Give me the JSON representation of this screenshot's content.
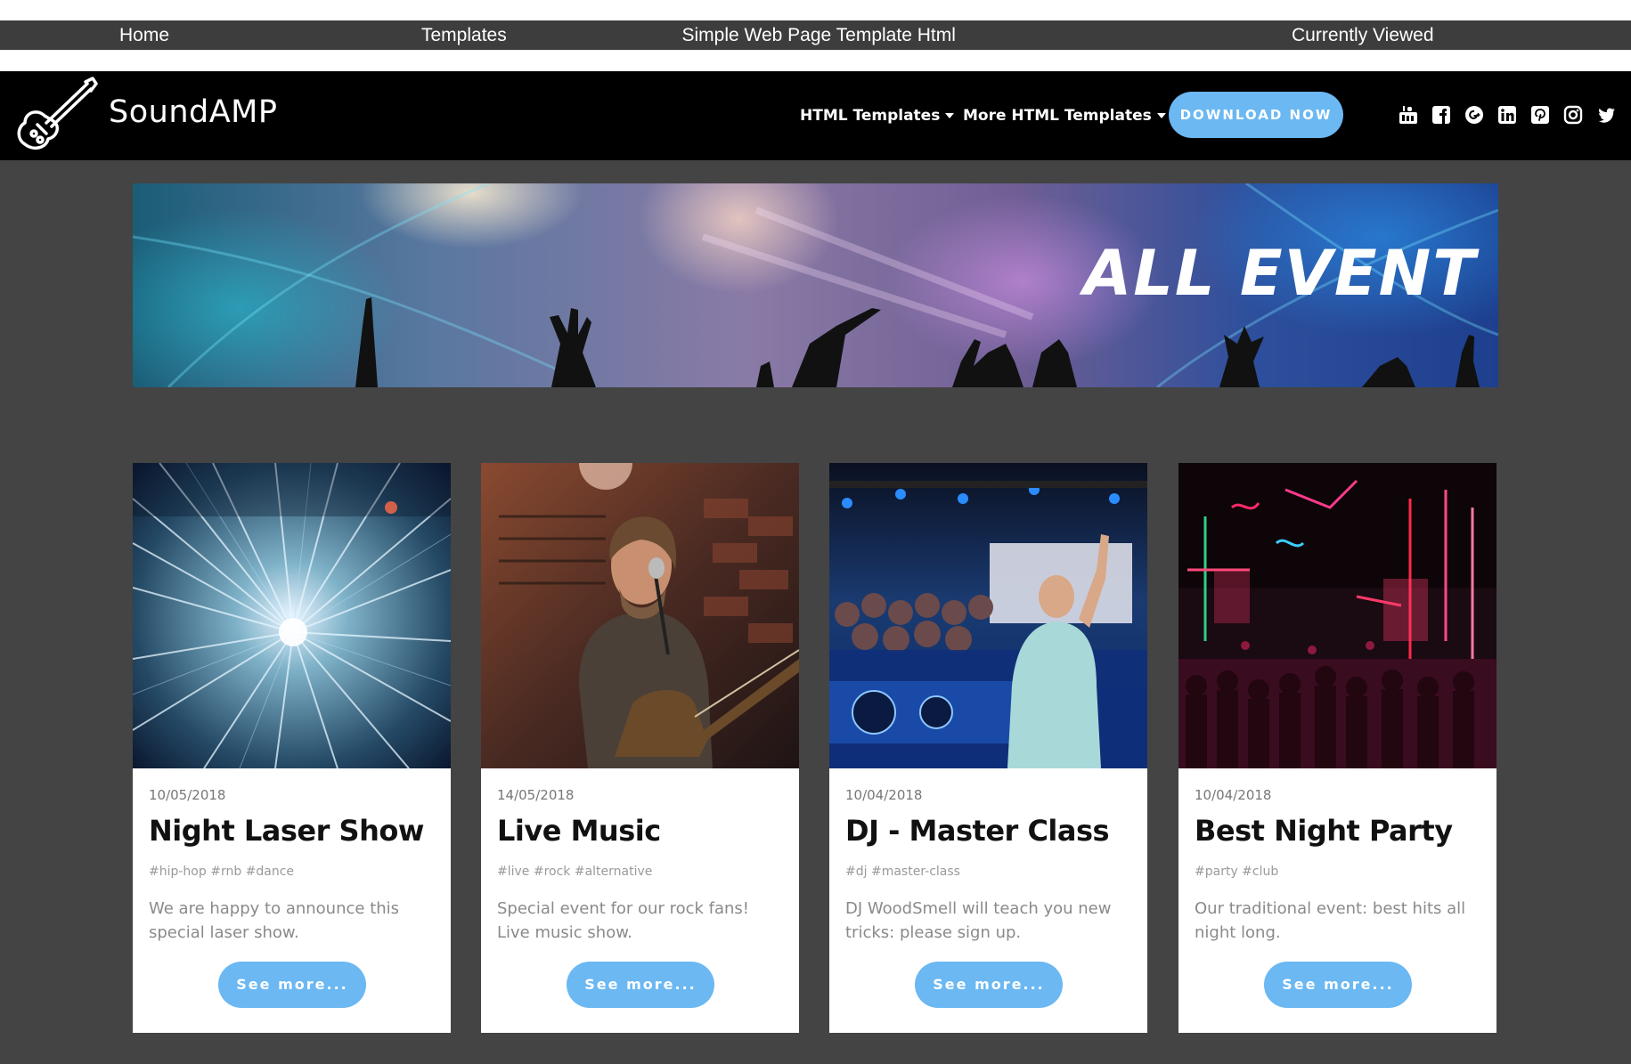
{
  "breadcrumb": {
    "items": [
      {
        "label": "Home"
      },
      {
        "label": "Templates"
      },
      {
        "label": "Simple Web Page Template Html"
      },
      {
        "label": "Currently Viewed"
      }
    ]
  },
  "header": {
    "brand": "SoundAMP",
    "logo_icon": "guitar-icon",
    "menus": [
      {
        "label": "HTML Templates"
      },
      {
        "label": "More HTML Templates"
      }
    ],
    "cta_label": "DOWNLOAD NOW",
    "social_icons": [
      "youtube-icon",
      "facebook-icon",
      "google-plus-icon",
      "linkedin-icon",
      "pinterest-icon",
      "instagram-icon",
      "twitter-icon"
    ]
  },
  "banner": {
    "title": "ALL EVENT"
  },
  "events": [
    {
      "date": "10/05/2018",
      "title": "Night Laser Show",
      "tags": "#hip-hop #rnb #dance",
      "description": "We are happy to announce this special laser show.",
      "button": "See more..."
    },
    {
      "date": "14/05/2018",
      "title": "Live Music",
      "tags": "#live #rock #alternative",
      "description": "Special event for our rock fans! Live music show.",
      "button": "See more..."
    },
    {
      "date": "10/04/2018",
      "title": "DJ - Master Class",
      "tags": "#dj #master-class",
      "description": "DJ WoodSmell will teach you new tricks: please sign up.",
      "button": "See more..."
    },
    {
      "date": "10/04/2018",
      "title": "Best Night Party",
      "tags": "#party #club",
      "description": "Our traditional event: best hits all night long.",
      "button": "See more..."
    }
  ],
  "colors": {
    "accent": "#6bb8f2",
    "navbar": "#000000",
    "page_background": "#444444",
    "breadcrumb_bar": "#3d3d3d"
  }
}
